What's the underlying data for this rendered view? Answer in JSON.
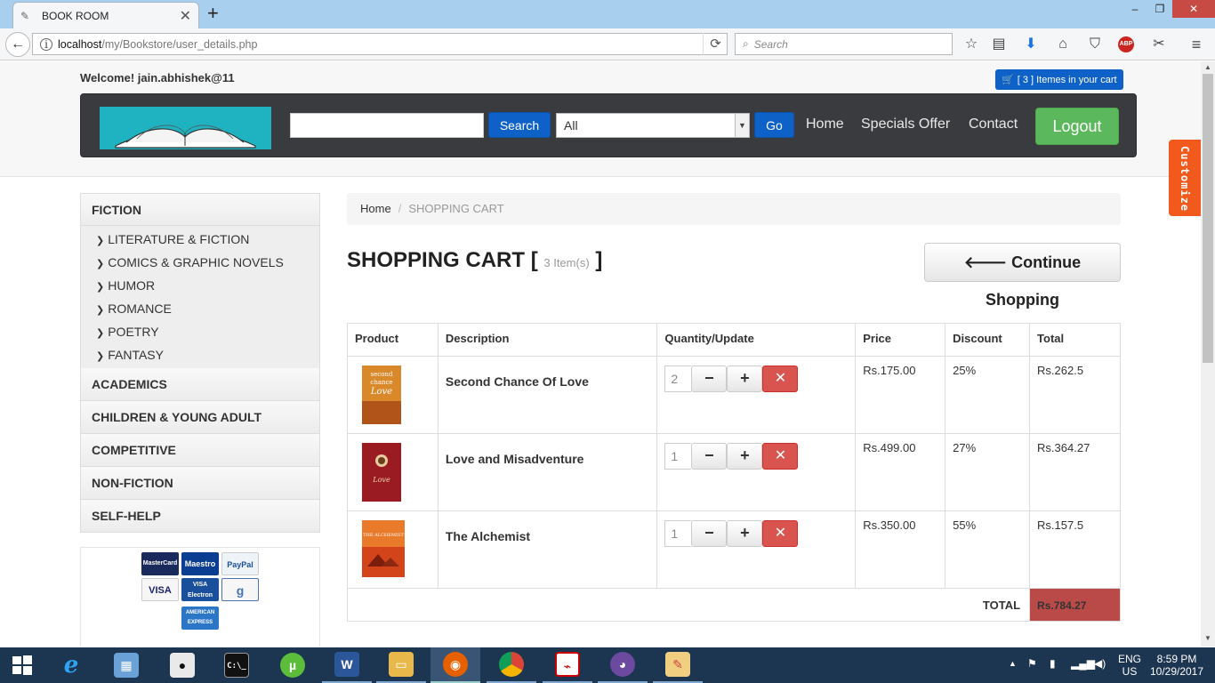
{
  "browser": {
    "tab_title": "BOOK ROOM",
    "url_host": "localhost",
    "url_path": "/my/Bookstore/user_details.php",
    "search_placeholder": "Search",
    "abp_label": "ABP"
  },
  "header": {
    "welcome": "Welcome! jain.abhishek@11",
    "cart_button": "[ 3 ] Itemes in your cart",
    "search_button": "Search",
    "category_select": "All",
    "go_button": "Go",
    "nav": [
      "Home",
      "Specials Offer",
      "Contact"
    ],
    "logout": "Logout",
    "customize": "Customize"
  },
  "sidebar": {
    "fiction": "FICTION",
    "fiction_sub": [
      "LITERATURE & FICTION",
      "COMICS & GRAPHIC NOVELS",
      "HUMOR",
      "ROMANCE",
      "POETRY",
      "FANTASY"
    ],
    "categories": [
      "ACADEMICS",
      "CHILDREN & YOUNG ADULT",
      "COMPETITIVE",
      "NON-FICTION",
      "SELF-HELP"
    ]
  },
  "payment_logos": {
    "mastercard": "MasterCard",
    "maestro": "Maestro",
    "paypal": "PayPal",
    "visa": "VISA",
    "visa_electron": "VISA Electron",
    "google": "g",
    "amex": "AMERICAN EXPRESS"
  },
  "breadcrumb": {
    "home": "Home",
    "current": "SHOPPING CART"
  },
  "cart": {
    "title": "SHOPPING CART",
    "bracket_open": "[",
    "bracket_close": "]",
    "count": "3 Item(s)",
    "continue_button": "Continue Shopping",
    "headers": [
      "Product",
      "Description",
      "Quantity/Update",
      "Price",
      "Discount",
      "Total"
    ],
    "rows": [
      {
        "title": "Second Chance Of Love",
        "qty": "2",
        "price": "Rs.175.00",
        "discount": "25%",
        "total": "Rs.262.5",
        "cover": "#d9882a",
        "cover_text": "second chance at Love"
      },
      {
        "title": "Love and Misadventure",
        "qty": "1",
        "price": "Rs.499.00",
        "discount": "27%",
        "total": "Rs.364.27",
        "cover": "#9b1b22",
        "cover_text": "Love"
      },
      {
        "title": "The Alchemist",
        "qty": "1",
        "price": "Rs.350.00",
        "discount": "55%",
        "total": "Rs.157.5",
        "cover": "#d3441b",
        "cover_text": "THE ALCHEMIST"
      }
    ],
    "minus": "−",
    "plus": "+",
    "remove": "✕",
    "total_label": "TOTAL",
    "total_value": "Rs.784.27"
  },
  "taskbar": {
    "lang": "ENG",
    "region": "US",
    "time": "8:59 PM",
    "date": "10/29/2017",
    "cmd_label": "C:\\_"
  }
}
